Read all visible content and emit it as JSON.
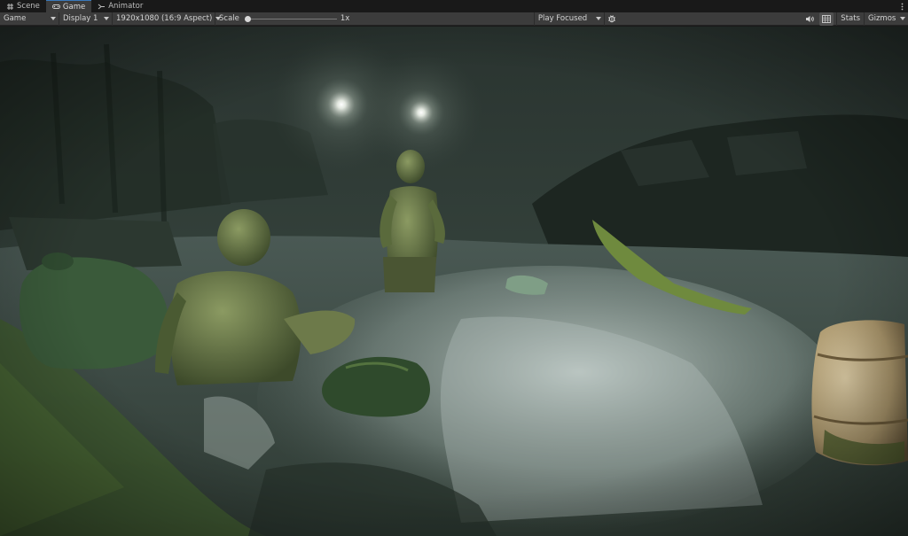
{
  "tabs": [
    {
      "label": "Scene",
      "icon": "hash-icon",
      "active": false
    },
    {
      "label": "Game",
      "icon": "gamepad-icon",
      "active": true
    },
    {
      "label": "Animator",
      "icon": "animator-icon",
      "active": false
    }
  ],
  "toolbar": {
    "view_mode": "Game",
    "display": "Display 1",
    "resolution": "1920x1080 (16:9 Aspect)",
    "scale_label": "Scale",
    "scale_value": "1x",
    "play_mode": "Play Focused",
    "stats_label": "Stats",
    "gizmos_label": "Gizmos"
  },
  "icons": {
    "debug": "bug-icon",
    "audio": "speaker-icon",
    "aspect_grid": "grid-icon",
    "more": "kebab-menu-icon"
  },
  "colors": {
    "tab_accent": "#3a79bb",
    "toolbar_bg": "#3c3c3c",
    "fog": "#2f3b34"
  }
}
